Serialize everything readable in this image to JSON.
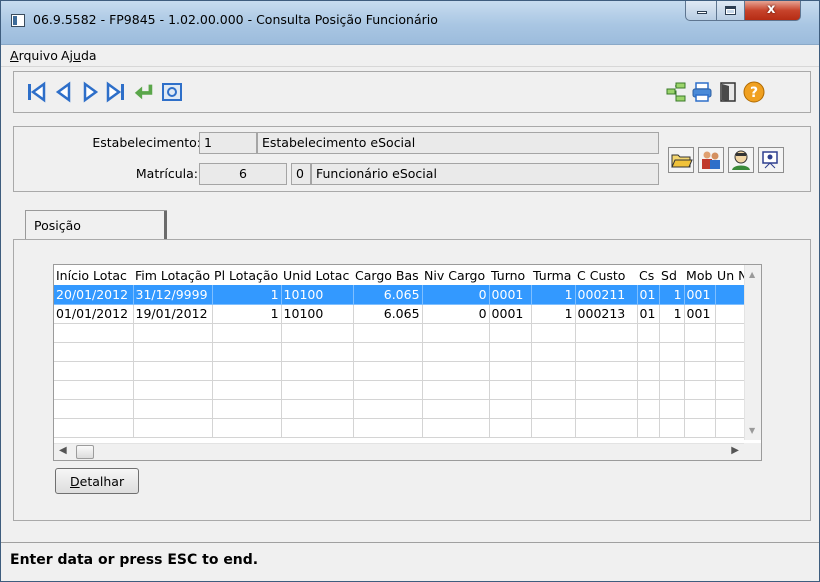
{
  "window": {
    "title": "06.9.5582 - FP9845 - 1.02.00.000 - Consulta Posição Funcionário",
    "close_glyph": "x"
  },
  "menu": {
    "items": [
      {
        "underline": "A",
        "rest": "rquivo"
      },
      {
        "pre": "Aj",
        "underline": "u",
        "rest": "da"
      }
    ]
  },
  "toolbar": {
    "icons": [
      "first-record-icon",
      "previous-record-icon",
      "next-record-icon",
      "last-record-icon",
      "return-icon",
      "preview-icon",
      "tree-icon",
      "printer-icon",
      "exit-door-icon",
      "help-icon"
    ],
    "help_glyph": "?"
  },
  "header": {
    "establishment_label": "Estabelecimento:",
    "establishment_code": "1",
    "establishment_name": "Estabelecimento eSocial",
    "registration_label": "Matrícula:",
    "registration_value": "6",
    "registration_digit": "0",
    "registration_name": "Funcionário eSocial"
  },
  "tabs": [
    {
      "label": "Posição"
    }
  ],
  "grid": {
    "columns": [
      "Início Lotac",
      "Fim Lotação",
      "Pl Lotação",
      "Unid Lotac",
      "Cargo Bas",
      "Niv Cargo",
      "Turno",
      "Turma",
      "C Custo",
      "Cs",
      "Sd",
      "Mob",
      "Un Ne"
    ],
    "rows": [
      [
        "20/01/2012",
        "31/12/9999",
        "1",
        "10100",
        "6.065",
        "0",
        "0001",
        "1",
        "000211",
        "01",
        "1",
        "001",
        ""
      ],
      [
        "01/01/2012",
        "19/01/2012",
        "1",
        "10100",
        "6.065",
        "0",
        "0001",
        "1",
        "000213",
        "01",
        "1",
        "001",
        ""
      ]
    ],
    "selected_row": 0,
    "empty_rows": 6
  },
  "detail_button": {
    "underline": "D",
    "rest": "etalhar"
  },
  "status": {
    "text": "Enter data or press ESC to end."
  },
  "colors": {
    "selection": "#3399ff",
    "nav_arrows": "#2e6fc9",
    "return_arrow": "#5aa64a",
    "help": "#f0a020"
  }
}
